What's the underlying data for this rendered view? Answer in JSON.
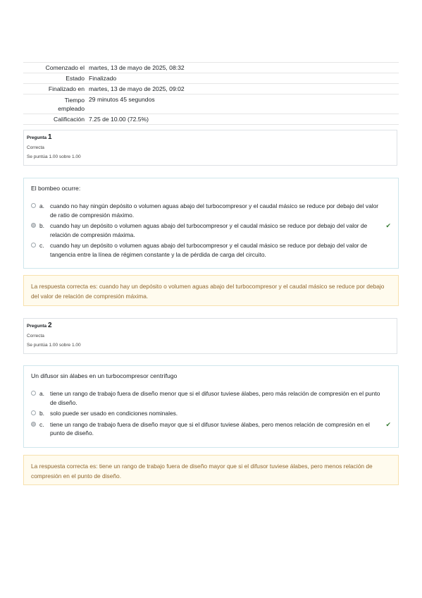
{
  "summary": {
    "started_label": "Comenzado el",
    "started_value": "martes, 13 de mayo de 2025, 08:32",
    "state_label": "Estado",
    "state_value": "Finalizado",
    "completed_label": "Finalizado en",
    "completed_value": "martes, 13 de mayo de 2025, 09:02",
    "time_label_1": "Tiempo",
    "time_label_2": "empleado",
    "time_value": "29 minutos 45 segundos",
    "grade_label": "Calificación",
    "grade_value": "7.25 de 10.00 (72.5%)"
  },
  "questions": [
    {
      "prefix": "Pregunta",
      "number": "1",
      "state": "Correcta",
      "grade": "Se puntúa 1.00 sobre 1.00",
      "text": "El bombeo ocurre:",
      "answers": [
        {
          "letter": "a.",
          "text": "cuando no hay ningún depósito o volumen aguas abajo del turbocompresor y el caudal másico se reduce por debajo del valor de ratio de compresión máximo.",
          "selected": false,
          "correct": false
        },
        {
          "letter": "b.",
          "text": "cuando hay un depósito o volumen aguas abajo del turbocompresor y el caudal másico se reduce por debajo del valor de relación de compresión máxima.",
          "selected": true,
          "correct": true
        },
        {
          "letter": "c.",
          "text": "cuando hay un depósito o volumen aguas abajo del turbocompresor y el caudal másico se reduce por debajo del valor de tangencia entre la línea de régimen constante y la de pérdida de carga del circuito.",
          "selected": false,
          "correct": false
        }
      ],
      "feedback": "La respuesta correcta es: cuando hay un depósito o volumen aguas abajo del turbocompresor y el caudal másico se reduce por debajo del valor de relación de compresión máxima."
    },
    {
      "prefix": "Pregunta",
      "number": "2",
      "state": "Correcta",
      "grade": "Se puntúa 1.00 sobre 1.00",
      "text": "Un difusor sin álabes en un turbocompresor centrífugo",
      "answers": [
        {
          "letter": "a.",
          "text": "tiene un rango de trabajo fuera de diseño menor que si el difusor tuviese álabes, pero más relación de compresión en el punto de diseño.",
          "selected": false,
          "correct": false
        },
        {
          "letter": "b.",
          "text": "solo puede ser usado en condiciones nominales.",
          "selected": false,
          "correct": false
        },
        {
          "letter": "c.",
          "text": "tiene un rango de trabajo fuera de diseño mayor que si el difusor tuviese álabes, pero menos relación de compresión en el punto de diseño.",
          "selected": true,
          "correct": true
        }
      ],
      "feedback": "La respuesta correcta es: tiene un rango de trabajo fuera de diseño mayor que si el difusor tuviese álabes, pero menos relación de compresión en el punto de diseño."
    }
  ],
  "colors": {
    "correct_check": "#357a32",
    "feedback_text": "#8e662e",
    "feedback_bg": "#fffbee"
  }
}
